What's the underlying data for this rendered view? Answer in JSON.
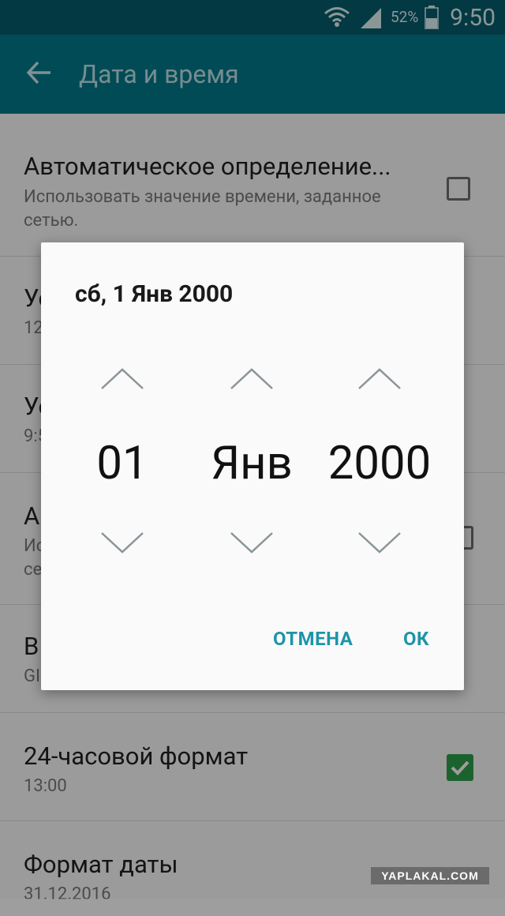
{
  "status_bar": {
    "battery_percent": "52%",
    "time": "9:50"
  },
  "app_bar": {
    "title": "Дата и время"
  },
  "settings": [
    {
      "title": "Автоматическое определение...",
      "subtitle": "Использовать значение времени, заданное сетью.",
      "checkbox": "unchecked"
    },
    {
      "title": "Ус",
      "subtitle": "12"
    },
    {
      "title": "Ус",
      "subtitle": "9:5"
    },
    {
      "title": "А",
      "subtitle": "Ис",
      "subtitle2": "се",
      "checkbox": "unchecked"
    },
    {
      "title": "В",
      "subtitle": "GI"
    },
    {
      "title": "24-часовой формат",
      "subtitle": "13:00",
      "checkbox": "checked"
    },
    {
      "title": "Формат даты",
      "subtitle": "31.12.2016"
    }
  ],
  "dialog": {
    "title": "сб, 1 Янв 2000",
    "day": "01",
    "month": "Янв",
    "year": "2000",
    "cancel_label": "ОТМЕНА",
    "ok_label": "ОК"
  },
  "watermark": "YAPLAKAL.COM",
  "colors": {
    "status_bar": "#055c6c",
    "app_bar": "#007a8b",
    "accent": "#1d95a8",
    "checkbox_checked": "#2e9e4c"
  }
}
